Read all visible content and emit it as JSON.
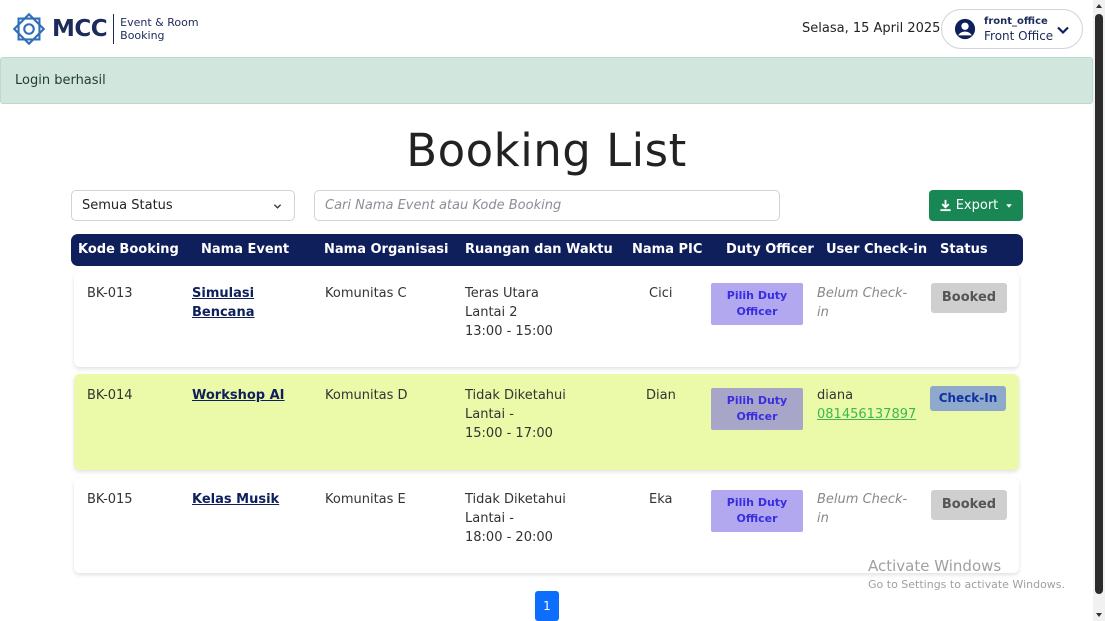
{
  "header": {
    "logo_text": "MCC",
    "logo_sub_line1": "Event & Room",
    "logo_sub_line2": "Booking",
    "date": "Selasa, 15 April 2025",
    "user_name": "front_office",
    "user_role": "Front Office"
  },
  "alert": {
    "text": "Login berhasil"
  },
  "page": {
    "title": "Booking List"
  },
  "filters": {
    "status_value": "Semua Status",
    "search_placeholder": "Cari Nama Event atau Kode Booking",
    "export_label": "Export"
  },
  "table": {
    "columns": [
      "Kode Booking",
      "Nama Event",
      "Nama Organisasi",
      "Ruangan dan Waktu",
      "Nama PIC",
      "Duty Officer",
      "User Check-in",
      "Status"
    ],
    "rows": [
      {
        "kode": "BK-013",
        "event_line1": "Simulasi",
        "event_line2": "Bencana",
        "organisasi": "Komunitas C",
        "ruangan": "Teras Utara",
        "lantai": "Lantai 2",
        "waktu": "13:00 - 15:00",
        "pic": "Cici",
        "duty_line1": "Pilih Duty",
        "duty_line2": "Officer",
        "checkin_line1": "Belum Check-",
        "checkin_line2": "in",
        "status": "Booked"
      },
      {
        "kode": "BK-014",
        "event_line1": "Workshop AI",
        "event_line2": "",
        "organisasi": "Komunitas D",
        "ruangan": "Tidak Diketahui",
        "lantai": "Lantai -",
        "waktu": "15:00 - 17:00",
        "pic": "Dian",
        "duty_line1": "Pilih Duty",
        "duty_line2": "Officer",
        "checkin_line1": "diana",
        "checkin_line2": "081456137897",
        "status": "Check-In"
      },
      {
        "kode": "BK-015",
        "event_line1": "Kelas Musik",
        "event_line2": "",
        "organisasi": "Komunitas E",
        "ruangan": "Tidak Diketahui",
        "lantai": "Lantai -",
        "waktu": "18:00 - 20:00",
        "pic": "Eka",
        "duty_line1": "Pilih Duty",
        "duty_line2": "Officer",
        "checkin_line1": "Belum Check-",
        "checkin_line2": "in",
        "status": "Booked"
      }
    ]
  },
  "pagination": {
    "current": "1"
  },
  "watermark": {
    "title": "Activate Windows",
    "subtitle": "Go to Settings to activate Windows."
  },
  "colors": {
    "navy": "#0e1f5b",
    "export_green": "#198754",
    "alert_bg": "#d1e7dd",
    "highlight_row": "#eafaa8",
    "duty_button": "#b1a8f0",
    "page_blue": "#0d6efd"
  },
  "icons": {
    "logo": "mcc-star-logo-icon",
    "user": "user-circle-icon",
    "chevron": "chevron-down-icon",
    "export": "download-icon",
    "caret": "caret-down-icon"
  }
}
